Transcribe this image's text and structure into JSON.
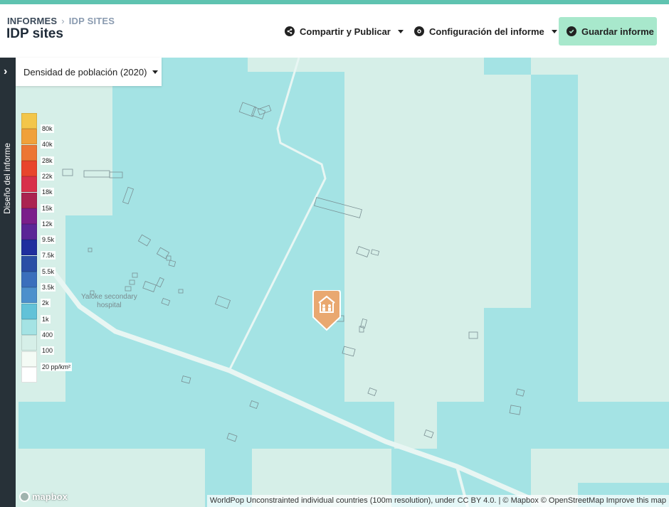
{
  "header": {
    "breadcrumb": {
      "root": "INFORMES",
      "separator": "›",
      "current": "IDP SITES"
    },
    "title": "IDP sites",
    "share_label": "Compartir y Publicar",
    "config_label": "Configuración del informe",
    "save_label": "Guardar informe"
  },
  "sidebar": {
    "label": "Diseño del informe",
    "toggle_icon": "chevron-right-icon"
  },
  "map": {
    "layer_select": "Densidad de población (2020)",
    "place_label_line1": "Yaloke secondary",
    "place_label_line2": "hospital",
    "legend": [
      {
        "label": "80k",
        "color": "#f3c64a"
      },
      {
        "label": "40k",
        "color": "#f0a13a"
      },
      {
        "label": "28k",
        "color": "#ec7633"
      },
      {
        "label": "22k",
        "color": "#e8452c"
      },
      {
        "label": "18k",
        "color": "#d8304a"
      },
      {
        "label": "15k",
        "color": "#aa2450"
      },
      {
        "label": "12k",
        "color": "#7a1e8a"
      },
      {
        "label": "9.5k",
        "color": "#5a2596"
      },
      {
        "label": "7.5k",
        "color": "#1f2f9e"
      },
      {
        "label": "5.5k",
        "color": "#2a4fa6"
      },
      {
        "label": "3.5k",
        "color": "#3a6fbc"
      },
      {
        "label": "2k",
        "color": "#4c90cc"
      },
      {
        "label": "1k",
        "color": "#62c2d8"
      },
      {
        "label": "400",
        "color": "#a4e3e4"
      },
      {
        "label": "100",
        "color": "#d6efe8"
      },
      {
        "label": "20 pp/km²",
        "color": "#f4fbf5"
      },
      {
        "label": "",
        "color": "#ffffff"
      }
    ],
    "attribution": "WorldPop Unconstrainted individual countries (100m resolution), under CC BY 4.0. | © Mapbox © OpenStreetMap Improve this map",
    "logo_text": "mapbox",
    "colors": {
      "high": "#a4e3e4",
      "low": "#d6efe8",
      "marker": "#e9a870"
    }
  }
}
